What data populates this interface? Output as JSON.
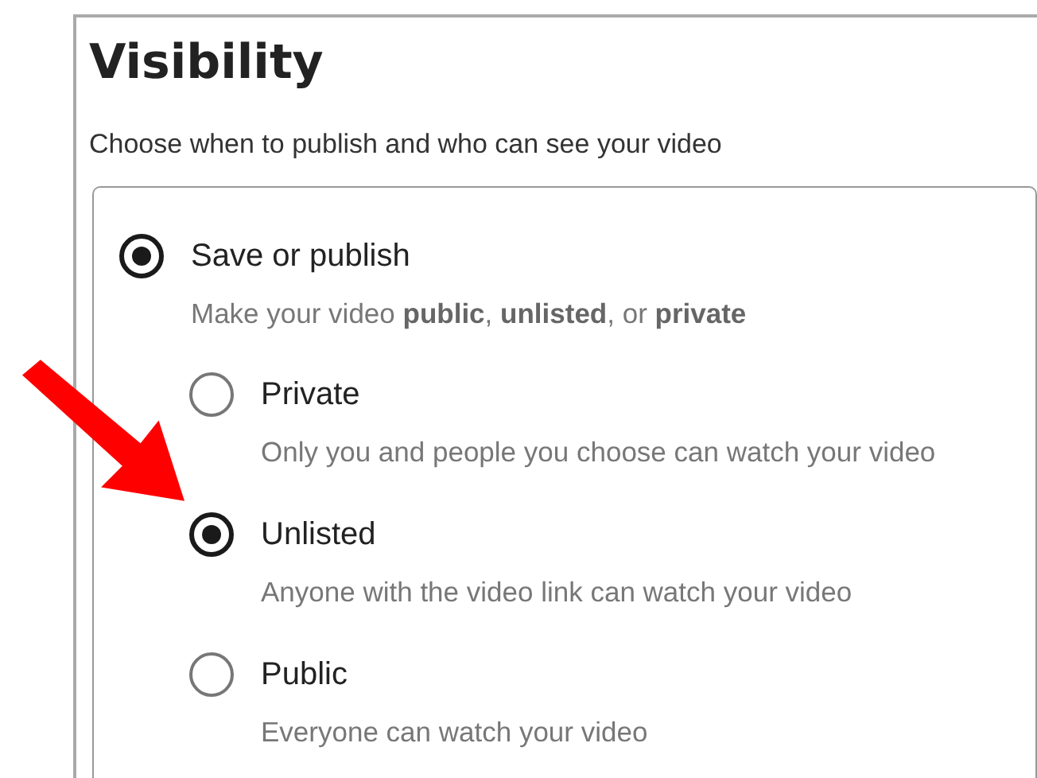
{
  "heading": "Visibility",
  "subheading": "Choose when to publish and who can see your video",
  "group": {
    "label": "Save or publish",
    "selected": true,
    "description": "Make your video **public**, **unlisted**, or **private**",
    "options": [
      {
        "label": "Private",
        "description": "Only you and people you choose can watch your video",
        "selected": false
      },
      {
        "label": "Unlisted",
        "description": "Anyone with the video link can watch your video",
        "selected": true
      },
      {
        "label": "Public",
        "description": "Everyone can watch your video",
        "selected": false
      }
    ]
  }
}
